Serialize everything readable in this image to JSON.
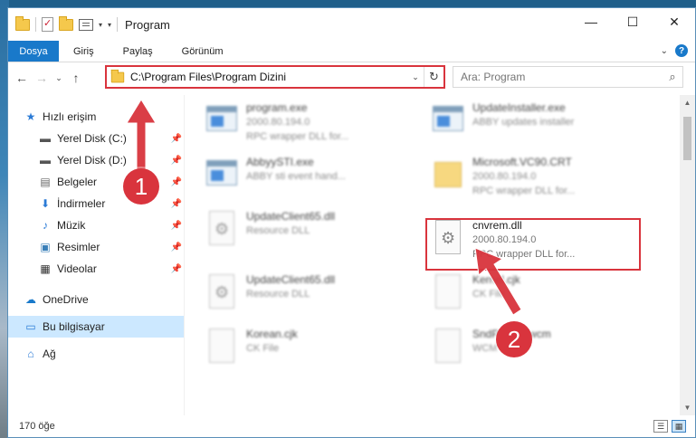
{
  "window": {
    "title": "Program",
    "controls": {
      "minimize": "—",
      "maximize": "☐",
      "close": "✕"
    }
  },
  "ribbon": {
    "tabs": [
      "Dosya",
      "Giriş",
      "Paylaş",
      "Görünüm"
    ]
  },
  "address": {
    "path": "C:\\Program Files\\Program Dizini",
    "search_placeholder": "Ara: Program"
  },
  "nav": {
    "quick_access": "Hızlı erişim",
    "items": [
      {
        "label": "Yerel Disk (C:)",
        "icon": "drive-icon"
      },
      {
        "label": "Yerel Disk (D:)",
        "icon": "drive-icon"
      },
      {
        "label": "Belgeler",
        "icon": "documents-icon"
      },
      {
        "label": "İndirmeler",
        "icon": "download-icon"
      },
      {
        "label": "Müzik",
        "icon": "music-icon"
      },
      {
        "label": "Resimler",
        "icon": "pictures-icon"
      },
      {
        "label": "Videolar",
        "icon": "videos-icon"
      }
    ],
    "onedrive": "OneDrive",
    "this_pc": "Bu bilgisayar",
    "network": "Ağ"
  },
  "files": [
    {
      "name": "program.exe",
      "line2": "2000.80.194.0",
      "line3": "RPC wrapper DLL for...",
      "icon": "exe"
    },
    {
      "name": "UpdateInstaller.exe",
      "line2": "ABBY updates installer",
      "line3": "",
      "icon": "exe"
    },
    {
      "name": "AbbyySTI.exe",
      "line2": "ABBY sti event hand...",
      "line3": "",
      "icon": "exe"
    },
    {
      "name": "Microsoft.VC90.CRT",
      "line2": "2000.80.194.0",
      "line3": "RPC wrapper DLL for...",
      "icon": "folder"
    },
    {
      "name": "UpdateClient65.dll",
      "line2": "Resource DLL",
      "line3": "",
      "icon": "dll"
    },
    {
      "name": "cnvrem.dll",
      "line2": "2000.80.194.0",
      "line3": "RPC wrapper DLL for...",
      "icon": "dll"
    },
    {
      "name": "UpdateClient65.dll",
      "line2": "Resource DLL",
      "line3": "",
      "icon": "dll"
    },
    {
      "name": "Kernel.cjk",
      "line2": "CK File",
      "line3": "",
      "icon": "file"
    },
    {
      "name": "Korean.cjk",
      "line2": "CK File",
      "line3": "",
      "icon": "file"
    },
    {
      "name": "SndPl2005.wcm",
      "line2": "WCM File",
      "line3": "",
      "icon": "file"
    }
  ],
  "status": {
    "count": "170 öğe"
  },
  "callouts": {
    "first": "1",
    "second": "2"
  },
  "colors": {
    "accent": "#1979ca",
    "highlight": "#d9343d",
    "selection": "#cce8ff"
  }
}
